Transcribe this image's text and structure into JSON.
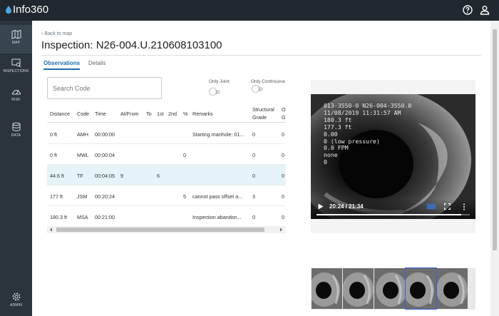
{
  "app": {
    "title": "Info360"
  },
  "header": {
    "help_icon": "help-circle-icon",
    "user_icon": "user-icon"
  },
  "sidebar": {
    "items": [
      {
        "label": "MAP",
        "icon": "map-icon",
        "active": true
      },
      {
        "label": "INSPECTIONS",
        "icon": "inspections-icon",
        "active": false
      },
      {
        "label": "RISK",
        "icon": "risk-icon",
        "active": false
      },
      {
        "label": "DATA",
        "icon": "data-icon",
        "active": false
      },
      {
        "label": "ADMIN",
        "icon": "gear-icon",
        "active": false
      }
    ]
  },
  "page": {
    "back_label": "Back to map",
    "title": "Inspection: N26-004.U.210608103100"
  },
  "tabs": [
    {
      "label": "Observations",
      "active": true
    },
    {
      "label": "Details",
      "active": false
    }
  ],
  "filters": {
    "search_placeholder": "Search Code",
    "only_joint_label": "Only Joint",
    "only_continuous_label": "Only Continuous",
    "only_joint_on": false,
    "only_continuous_on": false
  },
  "table": {
    "columns": [
      "Distance",
      "Code",
      "Time",
      "At/From",
      "To",
      "1st",
      "2nd",
      "%",
      "Remarks",
      "Structural",
      "Grade",
      "O",
      "G"
    ],
    "rows": [
      {
        "distance": "0 ft",
        "code": "AMH",
        "time": "00:00:00",
        "at_from": "",
        "to": "",
        "first": "",
        "second": "",
        "percent": "",
        "remarks": "Starting manhole: 01...",
        "structural_grade": "0",
        "other": "0",
        "selected": false
      },
      {
        "distance": "0 ft",
        "code": "MWL",
        "time": "00:00:04",
        "at_from": "",
        "to": "",
        "first": "",
        "second": "",
        "percent": "0",
        "remarks": "",
        "structural_grade": "0",
        "other": "0",
        "selected": false
      },
      {
        "distance": "44.6 ft",
        "code": "TF",
        "time": "00:04:05",
        "at_from": "9",
        "to": "",
        "first": "6",
        "second": "",
        "percent": "",
        "remarks": "",
        "structural_grade": "0",
        "other": "0",
        "selected": true
      },
      {
        "distance": "177 ft",
        "code": "JSM",
        "time": "00:20:24",
        "at_from": "",
        "to": "",
        "first": "",
        "second": "",
        "percent": "5",
        "remarks": "cannot pass offset a...",
        "structural_grade": "3",
        "other": "0",
        "selected": false
      },
      {
        "distance": "180.3 ft",
        "code": "MSA",
        "time": "00:21:00",
        "at_from": "",
        "to": "",
        "first": "",
        "second": "",
        "percent": "",
        "remarks": "Inspection abandon...",
        "structural_grade": "0",
        "other": "0",
        "selected": false
      }
    ]
  },
  "video": {
    "overlay_lines": [
      "013-3550-0 N26-004-3550.0",
      "11/08/2019 11:31:57 AM",
      "180.3 ft",
      "177.3 ft",
      "0.00",
      "0 (low pressure)",
      "0.0 FPM",
      "none",
      "0"
    ],
    "time_display": "20:24 / 21:34",
    "progress": 0.946,
    "play_icon": "play-icon",
    "fullscreen_icon": "fullscreen-icon",
    "more_icon": "more-vertical-icon",
    "cc_icon": "captions-icon"
  },
  "thumbnails": {
    "count": 5,
    "selected_index": 3
  }
}
